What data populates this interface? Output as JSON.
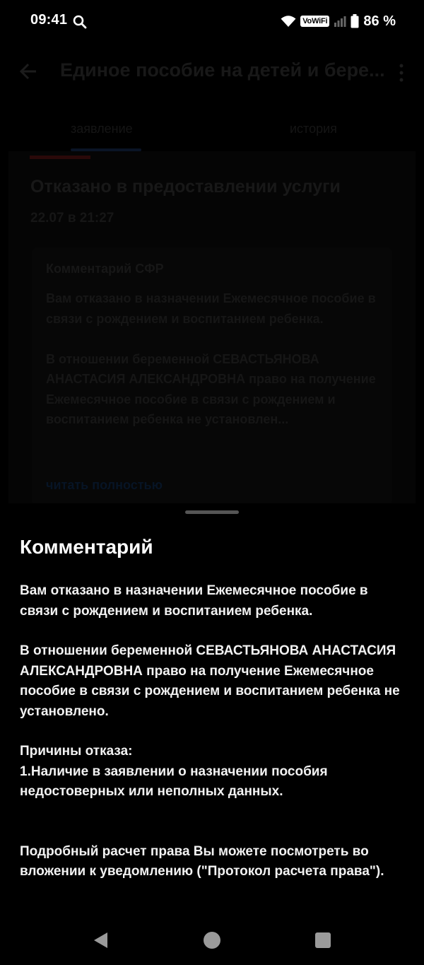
{
  "status_bar": {
    "time": "09:41",
    "network_label": "VoWiFi",
    "battery": "86 %"
  },
  "app_bar": {
    "title": "Единое пособие на детей и бере..."
  },
  "tabs": [
    {
      "label": "заявление",
      "active": true
    },
    {
      "label": "история",
      "active": false
    }
  ],
  "application": {
    "status": "Отказано в предоставлении услуги",
    "date": "22.07 в 21:27",
    "comment_card": {
      "title": "Комментарий СФР",
      "text": "Вам отказано в назначении Ежемесячное пособие в связи с рождением и воспитанием ребенка.\n\nВ отношении беременной СЕВАСТЬЯНОВА АНАСТАСИЯ АЛЕКСАНДРОВНА право на получение Ежемесячное пособие в связи с рождением и воспитанием ребенка не установлен...",
      "read_more": "читать полностью"
    }
  },
  "sheet": {
    "title": "Комментарий",
    "paragraph_1": "Вам отказано в назначении Ежемесячное пособие в связи с рождением и воспитанием ребенка.",
    "paragraph_2": "В отношении беременной СЕВАСТЬЯНОВА АНАСТАСИЯ АЛЕКСАНДРОВНА право на получение Ежемесячное пособие в связи с рождением и воспитанием ребенка не установлено.",
    "reasons_title": "Причины отказа:",
    "reason_1": "1.Наличие в заявлении о назначении пособия недостоверных или неполных данных.",
    "paragraph_3": "Подробный расчет права Вы можете посмотреть во вложении к уведомлению (\"Протокол расчета права\")."
  },
  "colors": {
    "background": "#000000",
    "text": "#ffffff",
    "dim_text": "#181818",
    "link_dim": "#071425"
  },
  "icons": {
    "status_search": "search-icon",
    "wifi": "wifi-icon",
    "signal": "signal-icon",
    "battery": "battery-icon",
    "back": "back-arrow-icon",
    "more": "more-vertical-icon",
    "nav_back": "nav-back-icon",
    "nav_home": "nav-home-icon",
    "nav_recent": "nav-recent-icon"
  }
}
